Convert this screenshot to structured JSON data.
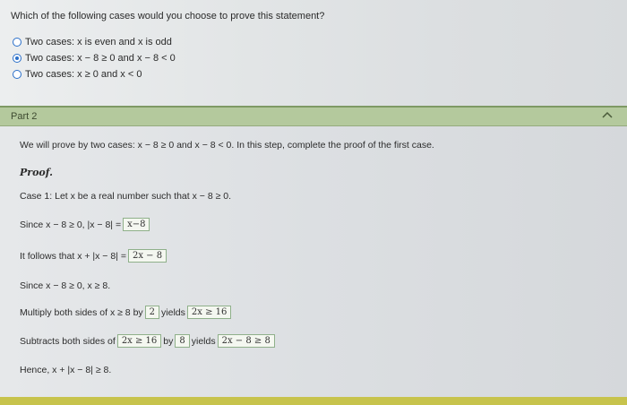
{
  "question": "Which of the following cases would you choose to prove this statement?",
  "options": [
    {
      "label": "Two cases: x is even and x is odd",
      "selected": false
    },
    {
      "label": "Two cases: x − 8 ≥ 0 and x − 8 < 0",
      "selected": true
    },
    {
      "label": "Two cases: x ≥ 0 and x < 0",
      "selected": false
    }
  ],
  "part": {
    "label": "Part 2",
    "chevron_icon": "chevron-up-icon"
  },
  "intro": "We will prove by two cases: x − 8 ≥ 0 and x − 8 < 0. In this step, complete the proof of the first case.",
  "proof_label": "Proof.",
  "case1": "Case 1: Let x be a real number such that x − 8 ≥ 0.",
  "step1": {
    "prefix": "Since x − 8 ≥ 0, |x − 8| =",
    "answer": "x−8"
  },
  "step2": {
    "prefix": "It follows that x + |x − 8| =",
    "answer": "2x − 8"
  },
  "step3": "Since x − 8 ≥ 0, x ≥ 8.",
  "step4": {
    "prefix": "Multiply both sides of x ≥ 8 by",
    "by": "2",
    "mid": "yields",
    "answer": "2x ≥ 16"
  },
  "step5": {
    "prefix": "Subtracts both sides of",
    "expr": "2x ≥ 16",
    "by_word": "by",
    "by": "8",
    "mid": "yields",
    "answer": "2x − 8 ≥ 8"
  },
  "step6": "Hence, x + |x − 8| ≥ 8.",
  "colors": {
    "accent": "#2a6fc9",
    "part_bar": "#b4c99d",
    "box_border": "#8fb08a",
    "bottom_bar": "#c7c34c"
  }
}
